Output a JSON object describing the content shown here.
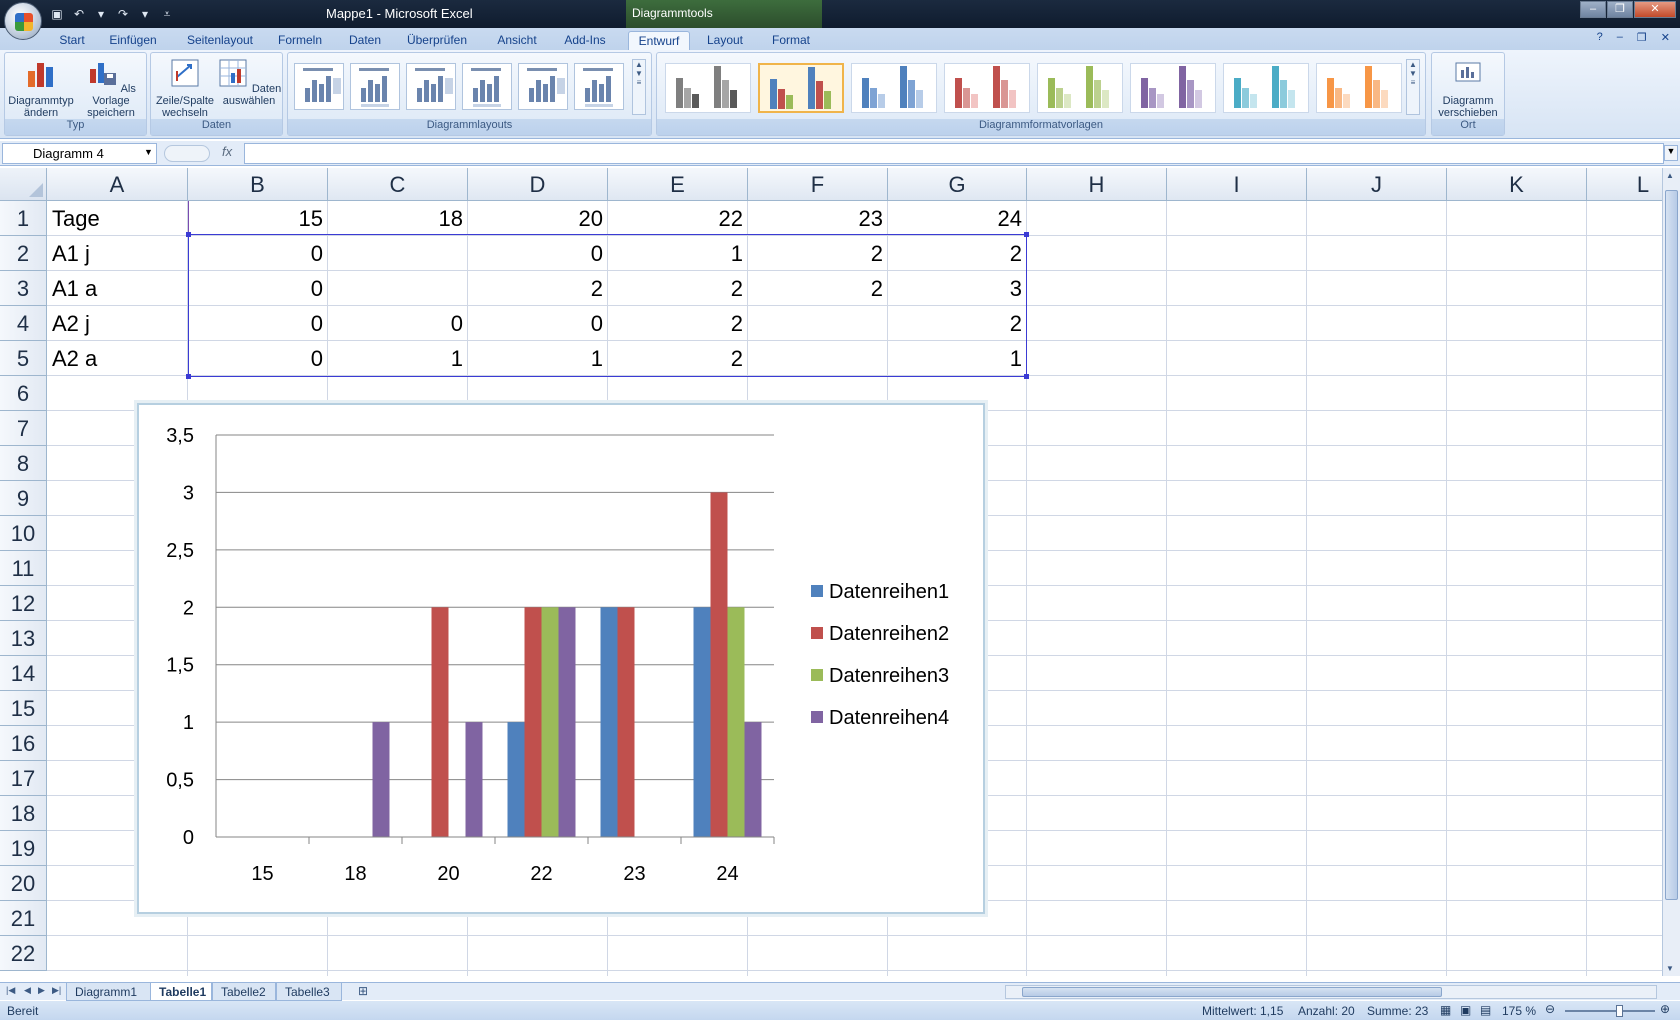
{
  "titlebar": {
    "title": "Mappe1 - Microsoft Excel",
    "context_title": "Diagrammtools"
  },
  "ribbon_tabs": [
    "Start",
    "Einfügen",
    "Seitenlayout",
    "Formeln",
    "Daten",
    "Überprüfen",
    "Ansicht",
    "Add-Ins",
    "Entwurf",
    "Layout",
    "Format"
  ],
  "active_tab": "Entwurf",
  "ribbon": {
    "typ": {
      "label": "Typ",
      "btn1": "Diagrammtyp ändern",
      "btn2": "Als Vorlage speichern"
    },
    "daten": {
      "label": "Daten",
      "btn1": "Zeile/Spalte wechseln",
      "btn2": "Daten auswählen"
    },
    "layouts": {
      "label": "Diagrammlayouts"
    },
    "styles": {
      "label": "Diagrammformatvorlagen",
      "colors": [
        [
          "#7f7f7f",
          "#a6a6a6",
          "#595959"
        ],
        [
          "#4f81bd",
          "#c0504d",
          "#9bbb59"
        ],
        [
          "#4f81bd",
          "#7ea3d4",
          "#b7cce8"
        ],
        [
          "#c0504d",
          "#d99694",
          "#f2c4c3"
        ],
        [
          "#9bbb59",
          "#bcd18f",
          "#dce8c4"
        ],
        [
          "#8064a2",
          "#a896c4",
          "#d2c8e2"
        ],
        [
          "#4bacc6",
          "#8ccbdc",
          "#c4e5ee"
        ],
        [
          "#f79646",
          "#f9b884",
          "#fcdabf"
        ]
      ]
    },
    "ort": {
      "label": "Ort",
      "btn1": "Diagramm verschieben"
    }
  },
  "formula_bar": {
    "name_box": "Diagramm 4",
    "fx": "fx",
    "formula": ""
  },
  "columns": [
    "A",
    "B",
    "C",
    "D",
    "E",
    "F",
    "G",
    "H",
    "I",
    "J",
    "K",
    "L"
  ],
  "rows": [
    "1",
    "2",
    "3",
    "4",
    "5",
    "6",
    "7",
    "8",
    "9",
    "10",
    "11",
    "12",
    "13",
    "14",
    "15",
    "16",
    "17",
    "18",
    "19",
    "20",
    "21",
    "22"
  ],
  "cells": [
    [
      "Tage",
      "15",
      "18",
      "20",
      "22",
      "23",
      "24"
    ],
    [
      "A1 j",
      "0",
      "",
      "0",
      "1",
      "2",
      "2"
    ],
    [
      "A1 a",
      "0",
      "",
      "2",
      "2",
      "2",
      "3"
    ],
    [
      "A2 j",
      "0",
      "0",
      "0",
      "2",
      "",
      "2"
    ],
    [
      "A2 a",
      "0",
      "1",
      "1",
      "2",
      "",
      "1"
    ]
  ],
  "chart_data": {
    "type": "bar",
    "categories": [
      "15",
      "18",
      "20",
      "22",
      "23",
      "24"
    ],
    "series": [
      {
        "name": "Datenreihen1",
        "values": [
          0,
          null,
          0,
          1,
          2,
          2
        ],
        "color": "#4f81bd"
      },
      {
        "name": "Datenreihen2",
        "values": [
          0,
          null,
          2,
          2,
          2,
          3
        ],
        "color": "#c0504d"
      },
      {
        "name": "Datenreihen3",
        "values": [
          0,
          0,
          0,
          2,
          null,
          2
        ],
        "color": "#9bbb59"
      },
      {
        "name": "Datenreihen4",
        "values": [
          0,
          1,
          1,
          2,
          null,
          1
        ],
        "color": "#8064a2"
      }
    ],
    "y_ticks": [
      "0",
      "0,5",
      "1",
      "1,5",
      "2",
      "2,5",
      "3",
      "3,5"
    ],
    "ylim": [
      0,
      3.5
    ],
    "grid": true,
    "legend_position": "right",
    "title": "",
    "xlabel": "",
    "ylabel": ""
  },
  "sheet_tabs": [
    "Diagramm1",
    "Tabelle1",
    "Tabelle2",
    "Tabelle3"
  ],
  "active_sheet": "Tabelle1",
  "status": {
    "ready": "Bereit",
    "average": "Mittelwert: 1,15",
    "count": "Anzahl: 20",
    "sum": "Summe: 23",
    "zoom": "175 %"
  }
}
